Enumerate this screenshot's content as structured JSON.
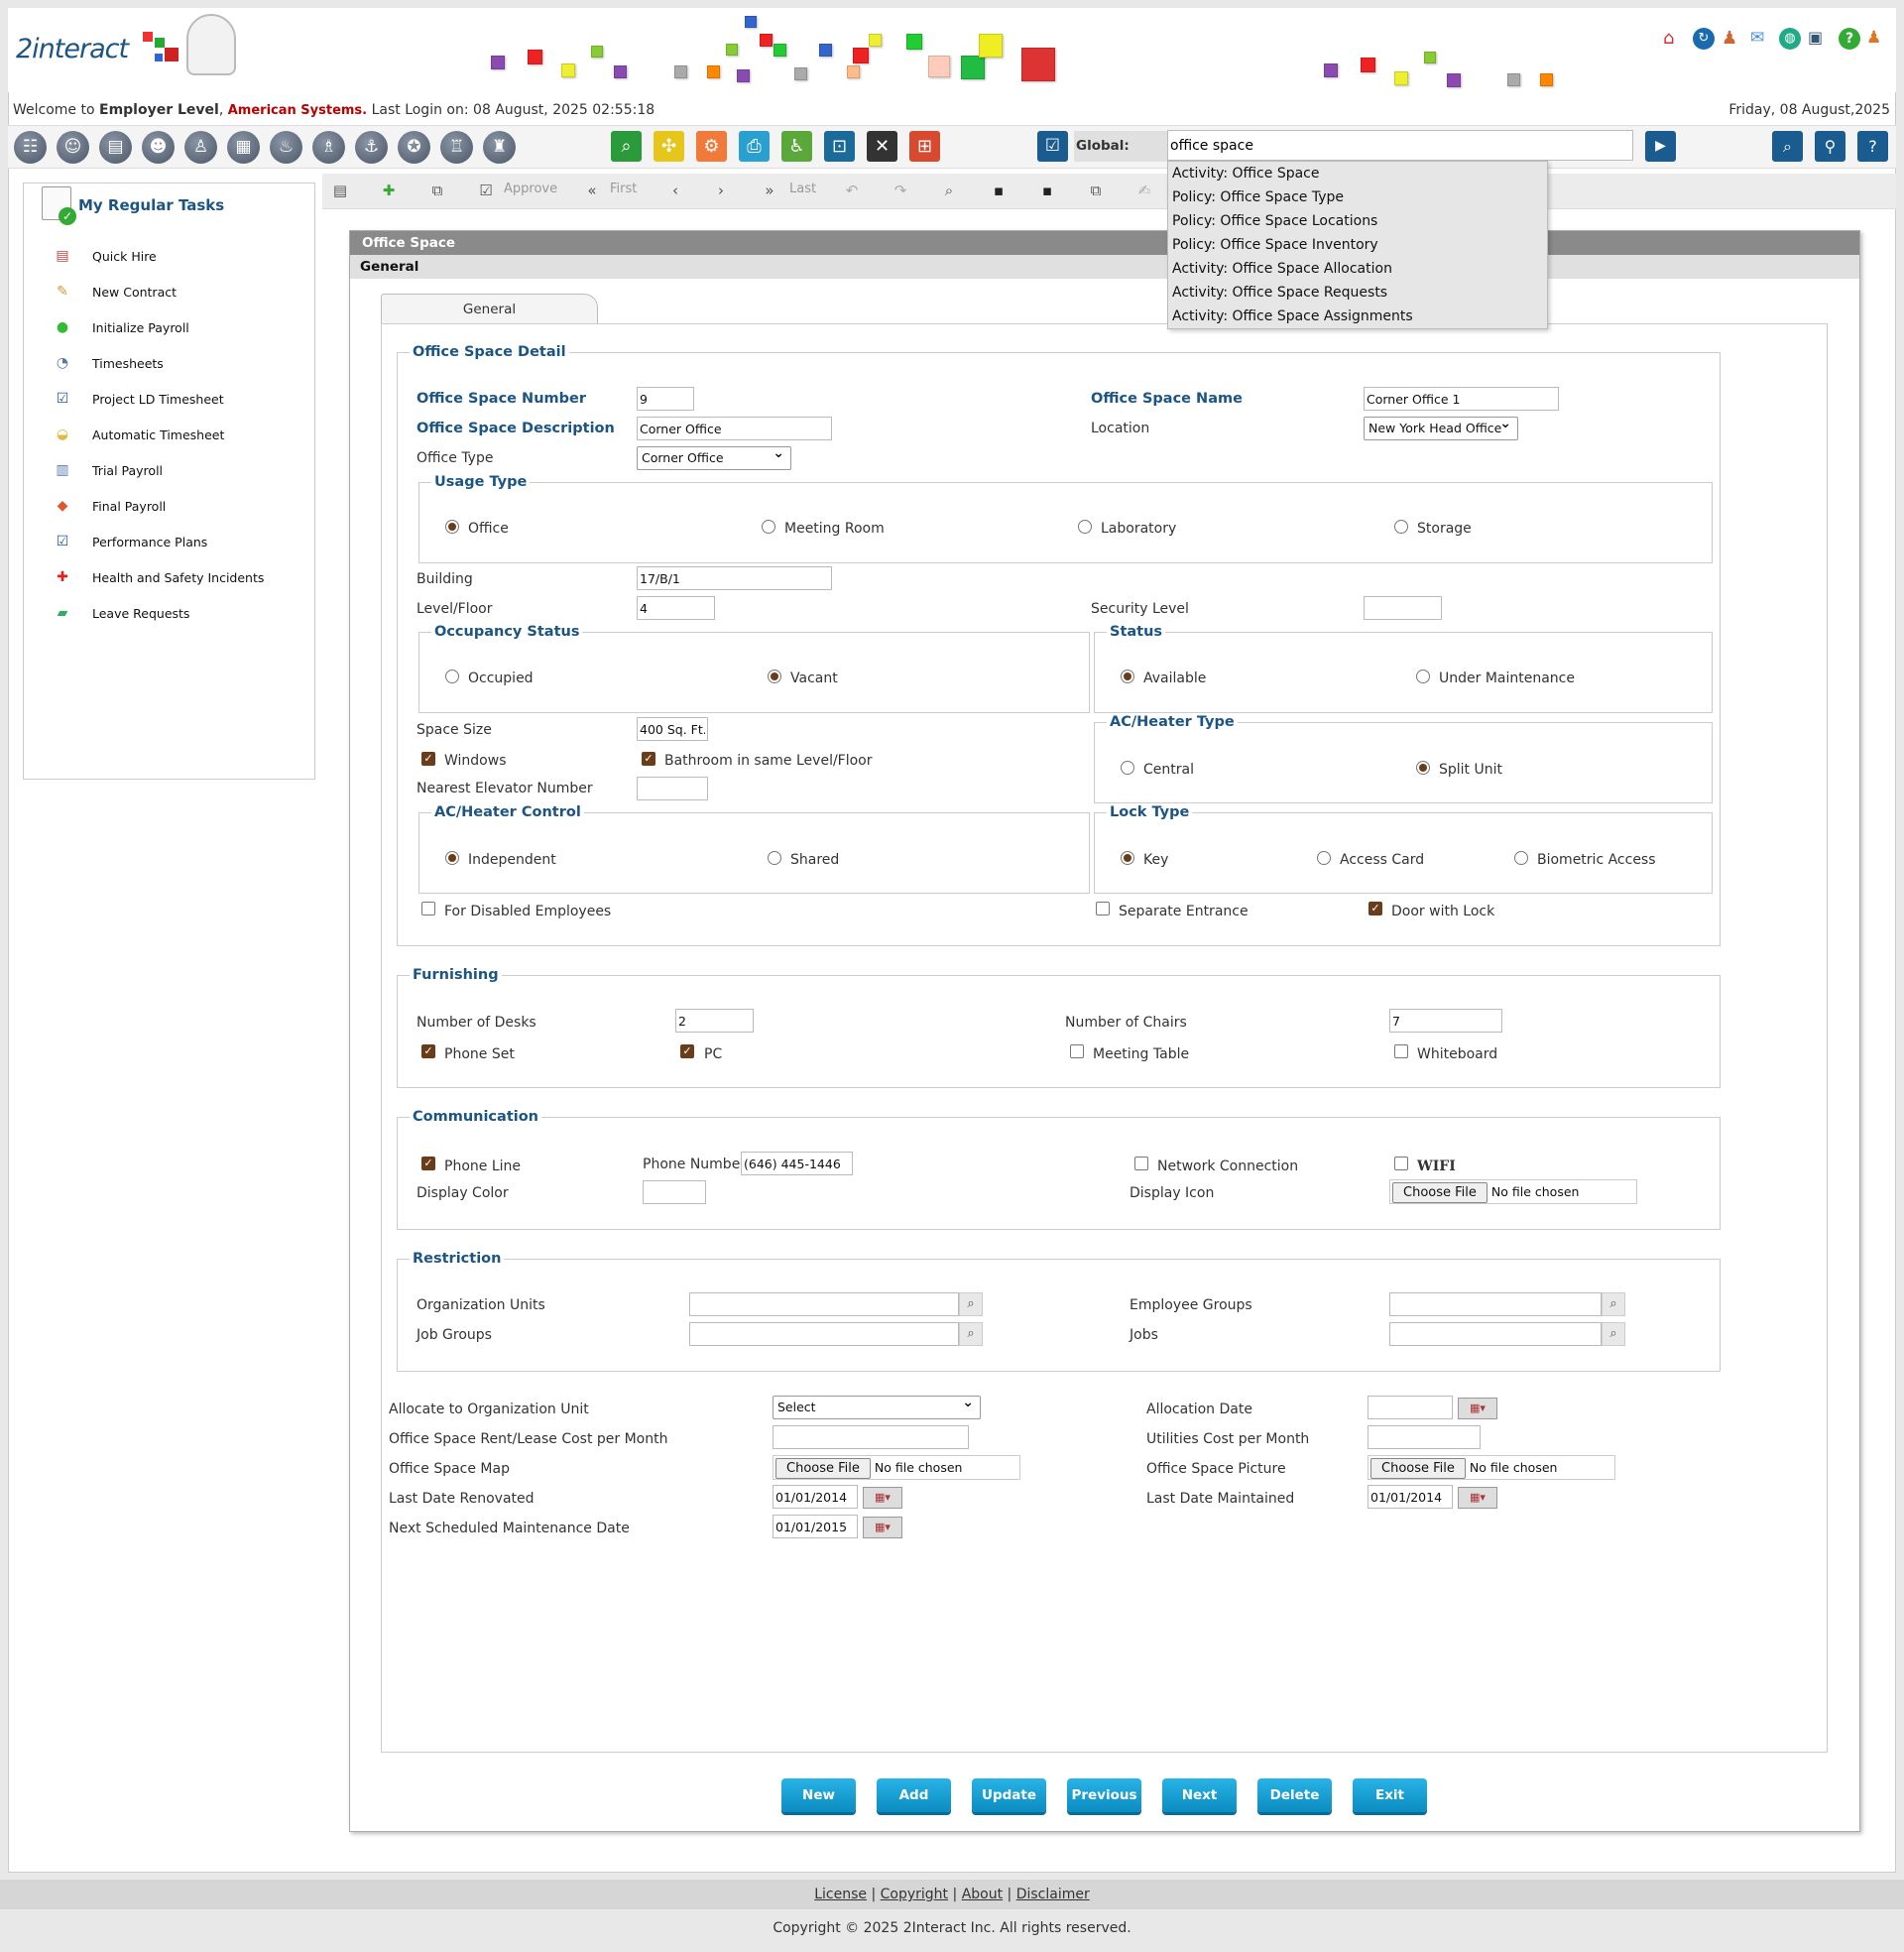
{
  "app": {
    "logo_text": "2interact",
    "brand_color": "#1c5584"
  },
  "welcome": {
    "prefix": "Welcome to",
    "level": "Employer Level",
    "company": "American Systems.",
    "last_login_label": "Last Login on:",
    "last_login": "08 August, 2025 02:55:18"
  },
  "date": "Friday, 08 August,2025",
  "global_search": {
    "label": "Global:",
    "value": "office space"
  },
  "suggestions": [
    "Activity: Office Space",
    "Policy: Office Space Type",
    "Policy: Office Space Locations",
    "Policy: Office Space Inventory",
    "Activity: Office Space Allocation",
    "Activity: Office Space Requests",
    "Activity: Office Space Assignments"
  ],
  "tasks": {
    "title": "My Regular Tasks",
    "items": [
      "Quick Hire",
      "New Contract",
      "Initialize Payroll",
      "Timesheets",
      "Project LD Timesheet",
      "Automatic Timesheet",
      "Trial Payroll",
      "Final Payroll",
      "Performance Plans",
      "Health and Safety Incidents",
      "Leave Requests"
    ]
  },
  "toolbar": {
    "approve": "Approve",
    "first": "First",
    "last": "Last"
  },
  "panel": {
    "title": "Office Space",
    "subtitle": "General",
    "tab": "General"
  },
  "detail": {
    "legend": "Office Space Detail",
    "number_label": "Office Space Number",
    "number": "9",
    "name_label": "Office Space Name",
    "name": "Corner Office 1",
    "desc_label": "Office Space Description",
    "desc": "Corner Office",
    "location_label": "Location",
    "location": "New York Head Office",
    "type_label": "Office Type",
    "type": "Corner Office",
    "usage_legend": "Usage Type",
    "usage": [
      "Office",
      "Meeting Room",
      "Laboratory",
      "Storage"
    ],
    "building_label": "Building",
    "building": "17/B/1",
    "level_label": "Level/Floor",
    "level": "4",
    "security_label": "Security Level",
    "security": "",
    "occupancy_legend": "Occupancy Status",
    "occupancy": [
      "Occupied",
      "Vacant"
    ],
    "status_legend": "Status",
    "status": [
      "Available",
      "Under Maintenance"
    ],
    "size_label": "Space Size",
    "size": "400 Sq. Ft.",
    "windows": "Windows",
    "bathroom": "Bathroom in same Level/Floor",
    "elevator_label": "Nearest Elevator Number",
    "elevator": "",
    "ac_type_legend": "AC/Heater Type",
    "ac_type": [
      "Central",
      "Split Unit"
    ],
    "ac_control_legend": "AC/Heater Control",
    "ac_control": [
      "Independent",
      "Shared"
    ],
    "lock_legend": "Lock Type",
    "lock": [
      "Key",
      "Access Card",
      "Biometric Access"
    ],
    "disabled": "For Disabled Employees",
    "separate": "Separate Entrance",
    "door": "Door with Lock"
  },
  "furnishing": {
    "legend": "Furnishing",
    "desks_label": "Number of Desks",
    "desks": "2",
    "chairs_label": "Number of Chairs",
    "chairs": "7",
    "phone_set": "Phone Set",
    "pc": "PC",
    "meeting_table": "Meeting Table",
    "whiteboard": "Whiteboard"
  },
  "communication": {
    "legend": "Communication",
    "phone_line": "Phone Line",
    "phone_number_label": "Phone Number",
    "phone_number": "(646) 445-1446",
    "network": "Network Connection",
    "wifi": "WIFI",
    "display_color_label": "Display Color",
    "display_icon_label": "Display Icon"
  },
  "restriction": {
    "legend": "Restriction",
    "org_units": "Organization Units",
    "emp_groups": "Employee Groups",
    "job_groups": "Job Groups",
    "jobs": "Jobs"
  },
  "allocation": {
    "org_unit_label": "Allocate to Organization Unit",
    "org_unit": "Select",
    "alloc_date_label": "Allocation Date",
    "alloc_date": "",
    "rent_label": "Office Space Rent/Lease Cost per Month",
    "utilities_label": "Utilities Cost per Month",
    "map_label": "Office Space Map",
    "picture_label": "Office Space Picture",
    "renovated_label": "Last Date Renovated",
    "renovated": "01/01/2014",
    "maintained_label": "Last Date Maintained",
    "maintained": "01/01/2014",
    "next_maint_label": "Next Scheduled Maintenance Date",
    "next_maint": "01/01/2015"
  },
  "file": {
    "choose": "Choose File",
    "none": "No file chosen"
  },
  "buttons": [
    "New",
    "Add",
    "Update",
    "Previous",
    "Next",
    "Delete",
    "Exit"
  ],
  "footer": {
    "links": [
      "License",
      "Copyright",
      "About",
      "Disclaimer"
    ],
    "copyright": "Copyright © 2025 2Interact Inc. All rights reserved."
  }
}
